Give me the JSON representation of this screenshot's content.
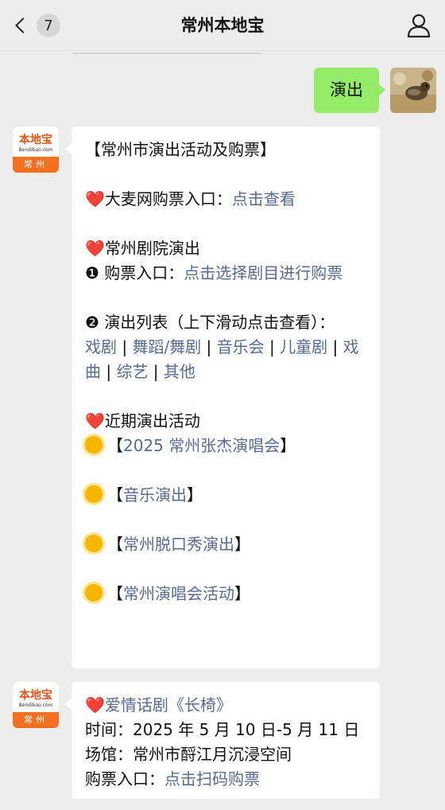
{
  "header": {
    "title": "常州本地宝",
    "unread_count": "7"
  },
  "messages": {
    "user_text": "演出",
    "bot_logo": {
      "brand": "本地宝",
      "site": "Bendibao.com",
      "city": "常州"
    },
    "reply1": {
      "heading": "【常州市演出活动及购票】",
      "damai_label": "大麦网购票入口：",
      "damai_link": "点击查看",
      "theatre_heading": "常州剧院演出",
      "buy_label": "❶ 购票入口：",
      "buy_link": "点击选择剧目进行购票",
      "list_label": "❷ 演出列表（上下滑动点击查看）：",
      "categories": [
        "戏剧",
        "舞蹈/舞剧",
        "音乐会",
        "儿童剧",
        "戏曲",
        "综艺",
        "其他"
      ],
      "recent_heading": "近期演出活动",
      "events": [
        "2025 常州张杰演唱会",
        "音乐演出",
        "常州脱口秀演出",
        "常州演唱会活动"
      ]
    },
    "reply2": {
      "title": "爱情话剧《长椅》",
      "time": "时间：2025 年 5 月 10 日-5 月 11 日",
      "venue": "场馆：常州市酹江月沉浸空间",
      "ticket_label": "购票入口：",
      "ticket_link": "点击扫码购票"
    }
  },
  "colors": {
    "link": "#576b95",
    "user_bubble": "#95ec69",
    "brand_orange": "#f37021"
  }
}
